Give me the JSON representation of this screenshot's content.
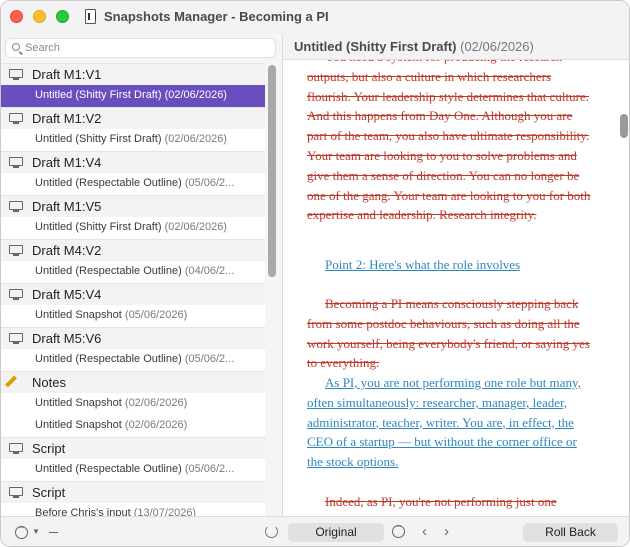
{
  "window": {
    "title": "Snapshots Manager - Becoming a PI"
  },
  "search": {
    "placeholder": "Search"
  },
  "groups": [
    {
      "label": "Draft M1:V1",
      "icon": "monitor-icon",
      "items": [
        {
          "title": "Untitled (Shitty First Draft)",
          "date": "(02/06/2026)",
          "selected": true
        }
      ]
    },
    {
      "label": "Draft M1:V2",
      "icon": "monitor-icon",
      "items": [
        {
          "title": "Untitled (Shitty First Draft)",
          "date": "(02/06/2026)"
        }
      ]
    },
    {
      "label": "Draft M1:V4",
      "icon": "monitor-icon",
      "items": [
        {
          "title": "Untitled (Respectable Outline)",
          "date": "(05/06/2..."
        }
      ]
    },
    {
      "label": "Draft M1:V5",
      "icon": "monitor-icon",
      "items": [
        {
          "title": "Untitled (Shitty First Draft)",
          "date": "(02/06/2026)"
        }
      ]
    },
    {
      "label": "Draft M4:V2",
      "icon": "monitor-icon",
      "items": [
        {
          "title": "Untitled (Respectable Outline)",
          "date": "(04/06/2..."
        }
      ]
    },
    {
      "label": "Draft M5:V4",
      "icon": "monitor-icon",
      "items": [
        {
          "title": "Untitled Snapshot",
          "date": "(05/06/2026)"
        }
      ]
    },
    {
      "label": "Draft M5:V6",
      "icon": "monitor-icon",
      "items": [
        {
          "title": "Untitled (Respectable Outline)",
          "date": "(05/06/2..."
        }
      ]
    },
    {
      "label": "Notes",
      "icon": "pencil-icon",
      "items": [
        {
          "title": "Untitled Snapshot",
          "date": "(02/06/2026)"
        },
        {
          "title": "Untitled Snapshot",
          "date": "(02/06/2026)"
        }
      ]
    },
    {
      "label": "Script",
      "icon": "monitor-icon",
      "items": [
        {
          "title": "Untitled (Respectable Outline)",
          "date": "(05/06/2..."
        }
      ]
    },
    {
      "label": "Script",
      "icon": "monitor-icon",
      "items": [
        {
          "title": "Before Chris's input",
          "date": "(13/07/2026)"
        }
      ]
    }
  ],
  "detail": {
    "title": "Untitled (Shitty First Draft)",
    "date": "(02/06/2026)",
    "paragraphs": [
      {
        "style": "deleted",
        "text": "You need a system for producing the research outputs, but also a culture in which researchers flourish. Your leadership style determines that culture. And this happens from Day One. Although you are part of the team, you also have ultimate responsibility. Your team are looking to you to solve problems and give them a sense of direction. You can no longer be one of the gang. Your team are looking to you for both expertise and leadership. Research integrity."
      },
      {
        "style": "inserted",
        "text": "Point 2: Here's what the role involves"
      },
      {
        "style": "deleted",
        "text": "Becoming a PI means consciously stepping back from some postdoc behaviours, such as doing all the work yourself, being everybody's friend, or saying yes to everything."
      },
      {
        "style": "inserted",
        "text": "As PI, you are not performing one role but many, often simultaneously: researcher, manager, leader, administrator, teacher, writer. You are, in effect, the CEO of a startup — but without the corner office or the stock options."
      },
      {
        "style": "deleted",
        "text": "Indeed, as PI, you're not performing just one"
      }
    ]
  },
  "footer": {
    "original_label": "Original",
    "rollback_label": "Roll Back"
  }
}
